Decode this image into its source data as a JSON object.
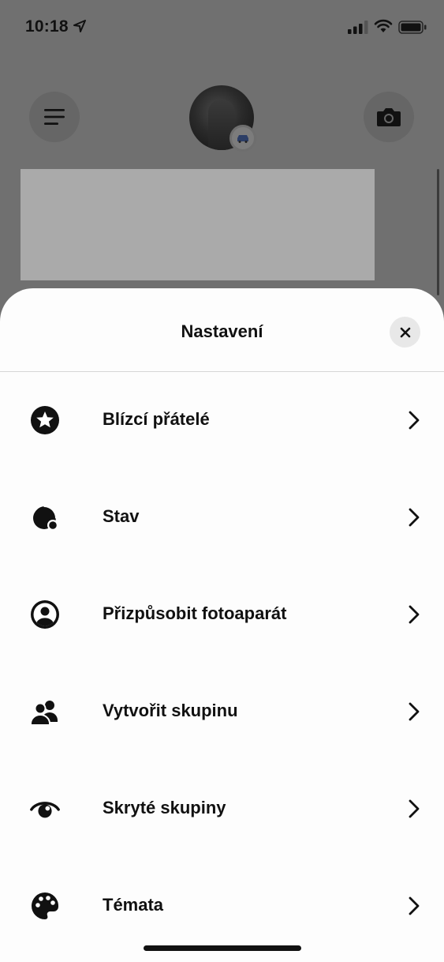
{
  "status_bar": {
    "time": "10:18",
    "icons": [
      "location-arrow-icon",
      "cellular-signal-icon",
      "wifi-icon",
      "battery-icon"
    ]
  },
  "background": {
    "buttons": [
      "menu-icon",
      "camera-icon"
    ],
    "avatar_badge_icon": "car-icon"
  },
  "sheet": {
    "title": "Nastavení",
    "close_icon": "close-icon",
    "items": [
      {
        "label": "Blízcí přátelé",
        "icon": "star-circle-icon"
      },
      {
        "label": "Stav",
        "icon": "status-icon"
      },
      {
        "label": "Přizpůsobit fotoaparát",
        "icon": "user-circle-icon"
      },
      {
        "label": "Vytvořit skupinu",
        "icon": "group-icon"
      },
      {
        "label": "Skryté skupiny",
        "icon": "eye-icon"
      },
      {
        "label": "Témata",
        "icon": "palette-icon"
      }
    ]
  },
  "colors": {
    "overlay": "#707070",
    "sheet": "#fdfdfd",
    "text": "#111111",
    "close_bg": "#e8e8e8"
  }
}
